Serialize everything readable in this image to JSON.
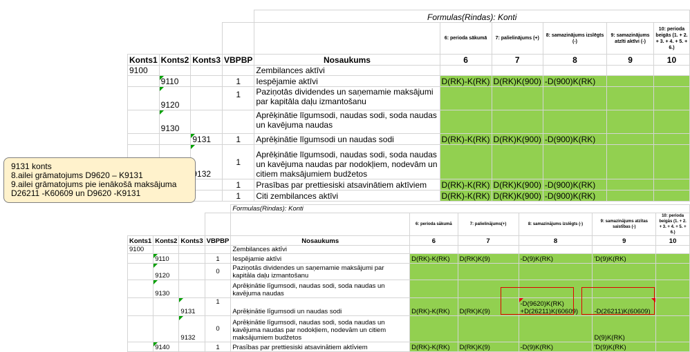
{
  "table1": {
    "title": "Formulas(Rindas): Konti",
    "headers": {
      "konts1": "Konts1",
      "konts2": "Konts2",
      "konts3": "Konts3",
      "vbpbp": "VBPBP",
      "nosaukums": "Nosaukums",
      "c6_desc": "6: perioda sākumā",
      "c7_desc": "7: palielinājums (+)",
      "c8_desc": "8: samazinājums izslēgts (-)",
      "c9_desc": "9: samazinājums atzīti aktīvi (-)",
      "c10_desc": "10: perioda beigās (1. + 2. + 3. + 4. + 5. + 6.)",
      "c6": "6",
      "c7": "7",
      "c8": "8",
      "c9": "9",
      "c10": "10"
    },
    "rows": [
      {
        "k1": "9100",
        "k2": "",
        "k3": "",
        "v": "",
        "name": "Zembilances aktīvi",
        "c6": "",
        "c7": "",
        "c8": ""
      },
      {
        "k1": "",
        "k2": "9110",
        "k3": "",
        "v": "1",
        "name": "Iespējamie aktīvi",
        "c6": "D(RK)-K(RK)",
        "c7": "D(RK)K(900)",
        "c8": "-D(900)K(RK)"
      },
      {
        "k1": "",
        "k2": "9120",
        "k3": "",
        "v": "1",
        "name": "Paziņotās dividendes un saņemamie maksājumi par kapitāla daļu izmantošanu",
        "c6": "",
        "c7": "",
        "c8": ""
      },
      {
        "k1": "",
        "k2": "9130",
        "k3": "",
        "v": "",
        "name": "Aprēķinātie līgumsodi, naudas sodi, soda naudas un kavējuma naudas",
        "c6": "",
        "c7": "",
        "c8": ""
      },
      {
        "k1": "",
        "k2": "",
        "k3": "9131",
        "v": "1",
        "name": "Aprēķinātie līgumsodi un naudas sodi",
        "c6": "D(RK)-K(RK)",
        "c7": "D(RK)K(900)",
        "c8": "-D(900)K(RK)"
      },
      {
        "k1": "",
        "k2": "",
        "k3": "9132",
        "v": "1",
        "name": "Aprēķinātie līgumsodi, naudas sodi, soda naudas un kavējuma naudas par nodokļiem, nodevām un citiem maksājumiem budžetos",
        "c6": "",
        "c7": "",
        "c8": ""
      },
      {
        "k1": "",
        "k2": "",
        "k3": "",
        "v": "1",
        "name": "Prasības par prettiesiski atsavinātiem aktīviem",
        "c6": "D(RK)-K(RK)",
        "c7": "D(RK)K(900)",
        "c8": "-D(900)K(RK)"
      },
      {
        "k1": "",
        "k2": "",
        "k3": "",
        "v": "1",
        "name": "Citi zembilances aktīvi",
        "c6": "D(RK)-K(RK)",
        "c7": "D(RK)K(900)",
        "c8": "-D(900)K(RK)"
      }
    ]
  },
  "note": {
    "line1": "9131 konts",
    "line2": "8.ailei grāmatojums D9620 – K9131",
    "line3": "9.ailei grāmatojums pie ienākošā maksājuma",
    "line4": "D26211 -K60609 un D9620 -K9131"
  },
  "table2": {
    "title": "Formulas(Rindas): Konti",
    "headers": {
      "konts1": "Konts1",
      "konts2": "Konts2",
      "konts3": "Konts3",
      "vbpbp": "VBPBP",
      "nosaukums": "Nosaukums",
      "c6_desc": "6: perioda sākumā",
      "c7_desc": "7: palielinājums(+)",
      "c8_desc": "8: samazinājums izslēgts (-)",
      "c9_desc": "9: samazinājums atzītas saistības (-)",
      "c10_desc": "10: perioda beigās (1. + 2. + 3. + 4. + 5. + 6.)",
      "c6": "6",
      "c7": "7",
      "c8": "8",
      "c9": "9",
      "c10": "10"
    },
    "rows": [
      {
        "k1": "9100",
        "k2": "",
        "k3": "",
        "v": "",
        "name": "Zembilances aktīvi",
        "c6": "",
        "c7": "",
        "c8": "",
        "c9": ""
      },
      {
        "k1": "",
        "k2": "9110",
        "k3": "",
        "v": "1",
        "name": "Iespējamie aktīvi",
        "c6": "D(RK)-K(RK)",
        "c7": "D(RK)K(9)",
        "c8": "-D(9)K(RK)",
        "c9": "'D(9)K(RK)"
      },
      {
        "k1": "",
        "k2": "9120",
        "k3": "",
        "v": "0",
        "name": "Paziņotās dividendes un saņemamie maksājumi par kapitāla daļu izmantošanu",
        "c6": "",
        "c7": "",
        "c8": "",
        "c9": ""
      },
      {
        "k1": "",
        "k2": "9130",
        "k3": "",
        "v": "",
        "name": "Aprēķinātie līgumsodi, naudas sodi, soda naudas un kavējuma naudas",
        "c6": "",
        "c7": "",
        "c8": "",
        "c9": ""
      },
      {
        "k1": "",
        "k2": "",
        "k3": "9131",
        "v": "1",
        "name": "Aprēķinātie līgumsodi un naudas sodi",
        "c6": "D(RK)-K(RK)",
        "c7": "D(RK)K(9)",
        "c8_l1": "-D(9620)K(RK)",
        "c8_l2": "+D(26211)K(60609)",
        "c9": "-D(26211)K(60609)"
      },
      {
        "k1": "",
        "k2": "",
        "k3": "9132",
        "v": "0",
        "name": "Aprēķinātie līgumsodi, naudas sodi, soda naudas un kavējuma naudas par nodokļiem, nodevām un citiem maksājumiem budžetos",
        "c6": "",
        "c7": "",
        "c8": "",
        "c9": "D(9)K(RK)"
      },
      {
        "k1": "",
        "k2": "9140",
        "k3": "",
        "v": "1",
        "name": "Prasības par prettiesiski atsavinātiem aktīviem",
        "c6": "D(RK)-K(RK)",
        "c7": "D(RK)K(9)",
        "c8": "-D(9)K(RK)",
        "c9": "'D(9)K(RK)"
      }
    ]
  }
}
